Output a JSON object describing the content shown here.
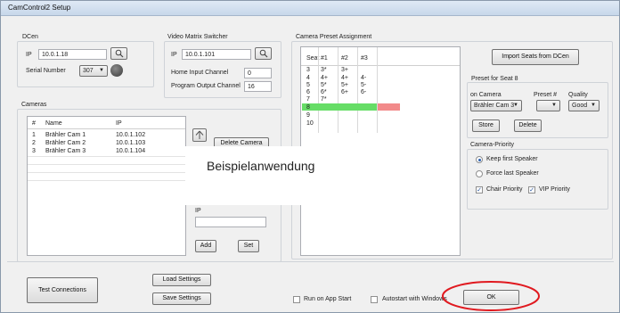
{
  "window": {
    "title": "CamControl2 Setup"
  },
  "dcen": {
    "group_label": "DCen",
    "ip_label": "IP",
    "ip_value": "10.0.1.18",
    "serial_label": "Serial Number",
    "serial_value": "307"
  },
  "vms": {
    "group_label": "Video Matrix Switcher",
    "ip_label": "IP",
    "ip_value": "10.0.1.101",
    "home_label": "Home Input Channel",
    "home_value": "0",
    "program_label": "Program Output Channel",
    "program_value": "16"
  },
  "cameras": {
    "group_label": "Cameras",
    "columns": [
      "#",
      "Name",
      "IP"
    ],
    "rows": [
      {
        "num": "1",
        "name": "Brähler Cam 1",
        "ip": "10.0.1.102"
      },
      {
        "num": "2",
        "name": "Brähler Cam 2",
        "ip": "10.0.1.103"
      },
      {
        "num": "3",
        "name": "Brähler Cam 3",
        "ip": "10.0.1.104"
      }
    ],
    "delete_label": "Delete Camera",
    "ip_label": "IP",
    "add_label": "Add",
    "set_label": "Set"
  },
  "overlay_text": "Beispielanwendung",
  "preset_assignment": {
    "group_label": "Camera Preset Assignment",
    "columns": [
      "Seat",
      "#1",
      "#2",
      "#3"
    ],
    "rows": [
      [
        "3",
        "3*",
        "3+",
        ""
      ],
      [
        "4",
        "4+",
        "4+",
        "4-"
      ],
      [
        "5",
        "5*",
        "5+",
        "5-"
      ],
      [
        "6",
        "6*",
        "6+",
        "6-"
      ],
      [
        "7",
        "7*",
        "",
        ""
      ],
      [
        "8",
        "",
        "",
        ""
      ],
      [
        "9",
        "",
        "",
        ""
      ],
      [
        "10",
        "",
        "",
        ""
      ]
    ],
    "highlight_green": "#66dd66",
    "highlight_red": "#f28a8a"
  },
  "import_label": "Import Seats from DCen",
  "preset_seat": {
    "group_label": "Preset for Seat 8",
    "camera_label": "on Camera",
    "preset_label": "Preset #",
    "quality_label": "Quality",
    "camera_value": "Brähler Cam 3",
    "preset_value": "",
    "quality_value": "Good",
    "store_label": "Store",
    "delete_label": "Delete"
  },
  "priority": {
    "group_label": "Camera-Priority",
    "keep_first": "Keep first Speaker",
    "force_last": "Force last Speaker",
    "chair_priority": "Chair Priority",
    "vip_priority": "VIP Priority",
    "selected": "keep_first",
    "chair_checked": true,
    "vip_checked": true
  },
  "bottom": {
    "test_label": "Test Connections",
    "load_label": "Load Settings",
    "save_label": "Save Settings",
    "run_on_start": "Run on App Start",
    "autostart": "Autostart with Windows",
    "ok_label": "OK",
    "circle_color": "#e0191f"
  }
}
